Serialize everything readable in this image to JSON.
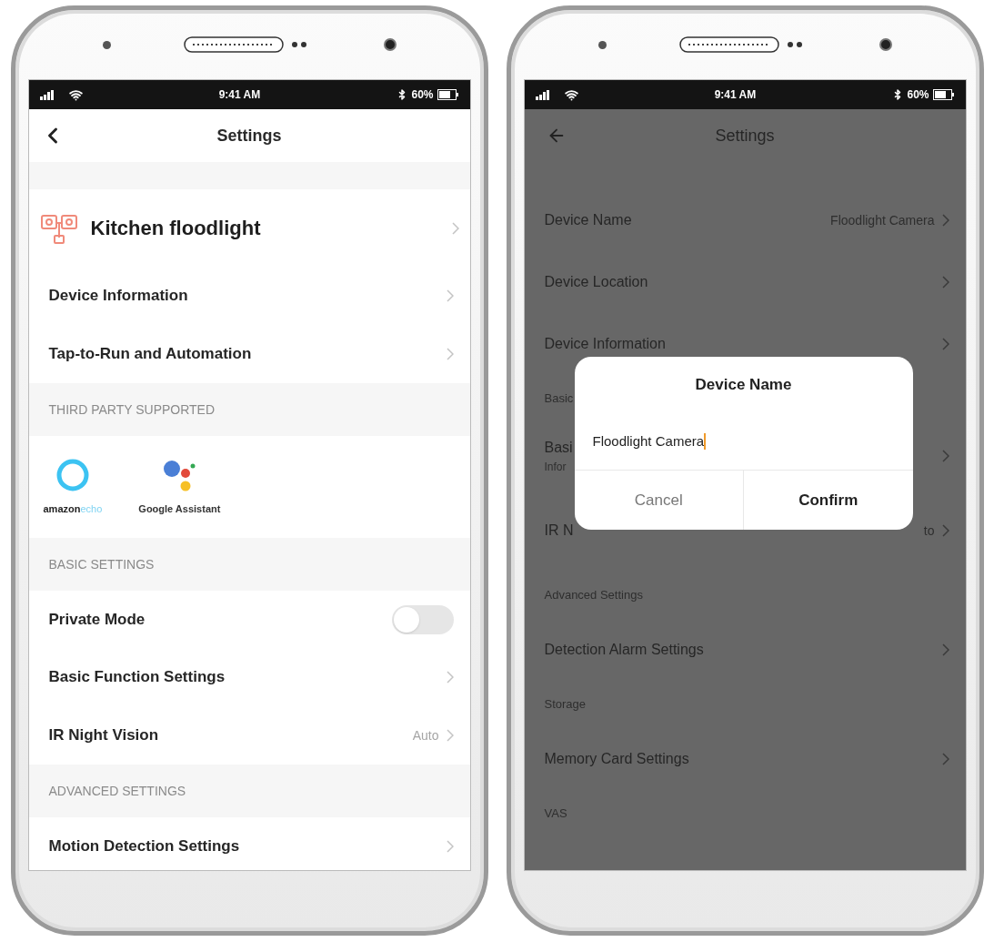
{
  "phones": [
    {
      "kind": "light",
      "status_bar": {
        "time": "9:41 AM",
        "battery": "60%"
      },
      "header": {
        "title": "Settings"
      },
      "rows": [
        {
          "kind": "device",
          "title": "Kitchen floodlight"
        },
        {
          "kind": "link",
          "title": "Device Information"
        },
        {
          "kind": "link",
          "title": "Tap-to-Run and Automation"
        },
        {
          "kind": "section",
          "label": "THIRD PARTY SUPPORTED"
        },
        {
          "kind": "integrations",
          "items": [
            {
              "kind": "echo",
              "brand": "amazon",
              "product": "echo"
            },
            {
              "kind": "assistant",
              "label": "Google Assistant"
            }
          ]
        },
        {
          "kind": "section",
          "label": "BASIC SETTINGS"
        },
        {
          "kind": "toggle",
          "title": "Private Mode",
          "on": false
        },
        {
          "kind": "link",
          "title": "Basic Function Settings"
        },
        {
          "kind": "link",
          "title": "IR Night Vision",
          "value": "Auto"
        },
        {
          "kind": "section",
          "label": "ADVANCED SETTINGS"
        },
        {
          "kind": "link",
          "title": "Motion Detection Settings"
        }
      ]
    },
    {
      "kind": "dimmed",
      "status_bar": {
        "time": "9:41 AM",
        "battery": "60%"
      },
      "header": {
        "title": "Settings"
      },
      "rows": [
        {
          "kind": "link",
          "title": "Device Name",
          "value": "Floodlight Camera"
        },
        {
          "kind": "link",
          "title": "Device Location"
        },
        {
          "kind": "link",
          "title": "Device Information"
        },
        {
          "kind": "section",
          "label": "Basic"
        },
        {
          "kind": "link",
          "title": "Basi",
          "subtitle": "Infor"
        },
        {
          "kind": "link",
          "title": "IR N",
          "value": "to"
        },
        {
          "kind": "section",
          "label": "Advanced Settings"
        },
        {
          "kind": "link",
          "title": "Detection Alarm Settings"
        },
        {
          "kind": "section",
          "label": "Storage"
        },
        {
          "kind": "link",
          "title": "Memory Card Settings"
        },
        {
          "kind": "section",
          "label": "VAS"
        }
      ],
      "dialog": {
        "title": "Device Name",
        "value": "Floodlight Camera",
        "buttons": [
          {
            "kind": "cancel",
            "label": "Cancel"
          },
          {
            "kind": "confirm",
            "label": "Confirm"
          }
        ]
      }
    }
  ]
}
